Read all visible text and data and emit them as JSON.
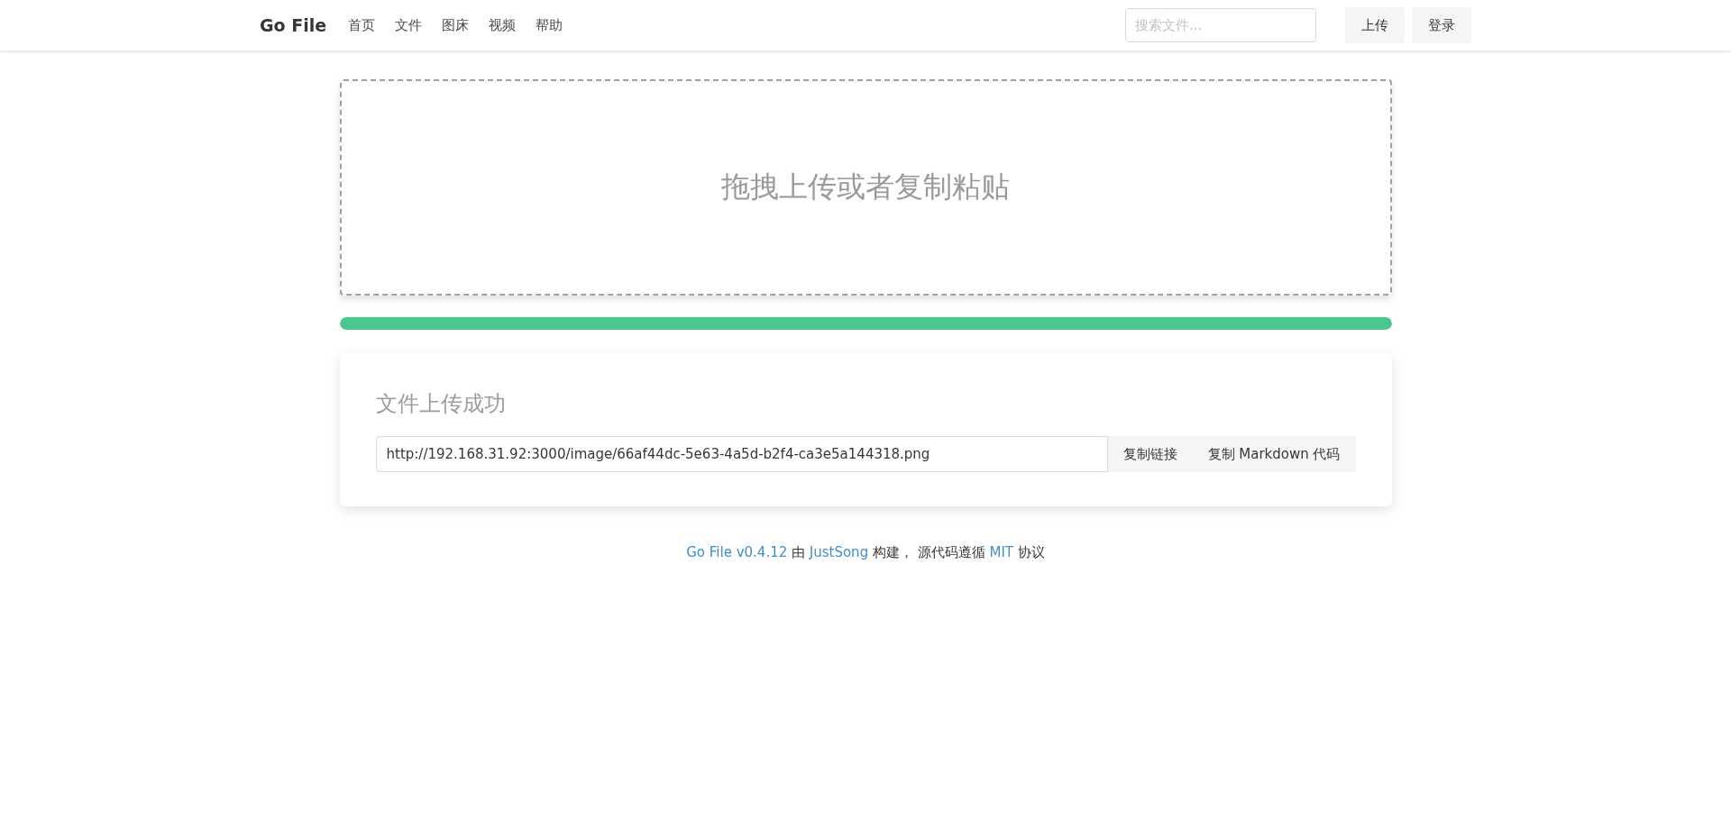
{
  "navbar": {
    "brand": "Go File",
    "links": [
      "首页",
      "文件",
      "图床",
      "视频",
      "帮助"
    ],
    "search": {
      "placeholder": "搜索文件..."
    },
    "buttons": [
      "上传",
      "登录"
    ]
  },
  "dropzone": {
    "text": "拖拽上传或者复制粘贴"
  },
  "progress": {
    "level": 1
  },
  "result": {
    "title": "文件上传成功",
    "url": "http://192.168.31.92:3000/image/66af44dc-5e63-4a5d-b2f4-ca3e5a144318.png",
    "buttons": [
      "复制链接",
      "复制 Markdown 代码"
    ]
  },
  "footer": [
    {
      "kind": "link",
      "text": "Go File v0.4.12"
    },
    {
      "kind": "text",
      "text": " 由 "
    },
    {
      "kind": "link",
      "text": "JustSong"
    },
    {
      "kind": "text",
      "text": " 构建， 源代码遵循 "
    },
    {
      "kind": "link",
      "text": "MIT"
    },
    {
      "kind": "text",
      "text": " 协议"
    }
  ]
}
